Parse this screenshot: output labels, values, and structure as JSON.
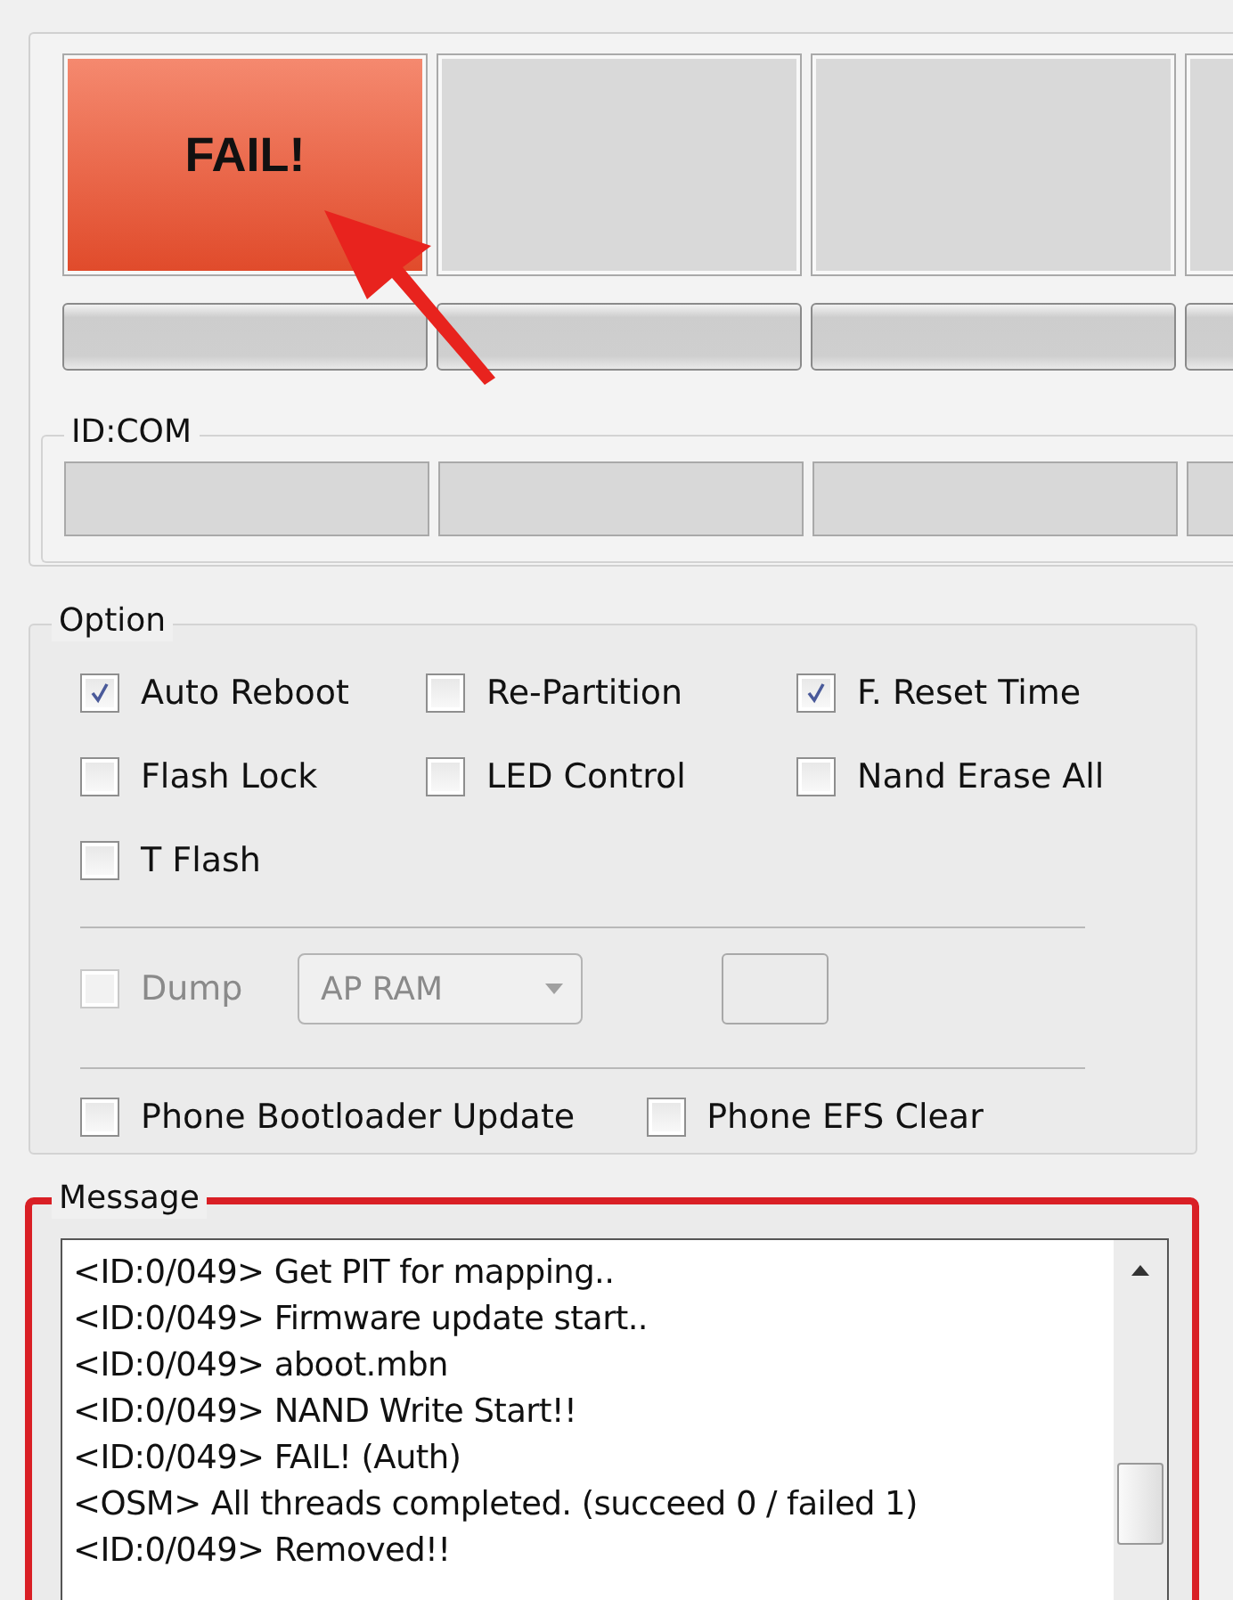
{
  "slots": [
    {
      "kind": "fail",
      "status": "FAIL!",
      "level": 0
    },
    {
      "kind": "idle",
      "level": 0
    },
    {
      "kind": "idle",
      "level": 0
    },
    {
      "kind": "idle",
      "level": 0
    }
  ],
  "id_com": {
    "title": "ID:COM"
  },
  "option": {
    "title": "Option",
    "checkboxes": [
      {
        "label": "Auto Reboot",
        "checked": true
      },
      {
        "label": "Re-Partition",
        "checked": false
      },
      {
        "label": "F. Reset Time",
        "checked": true
      },
      {
        "label": "Flash Lock",
        "checked": false
      },
      {
        "label": "LED Control",
        "checked": false
      },
      {
        "label": "Nand Erase All",
        "checked": false
      },
      {
        "label": "T Flash",
        "checked": false
      }
    ],
    "dump": {
      "label": "Dump",
      "checked": false,
      "disabled": true,
      "dropdown": "AP RAM"
    },
    "phone": [
      {
        "label": "Phone Bootloader Update",
        "checked": false
      },
      {
        "label": "Phone EFS Clear",
        "checked": false
      }
    ]
  },
  "message": {
    "title": "Message",
    "highlighted": true,
    "lines": [
      "<ID:0/049> Get PIT for mapping..",
      "<ID:0/049> Firmware update start..",
      "<ID:0/049> aboot.mbn",
      "<ID:0/049> NAND Write Start!!",
      "<ID:0/049> FAIL! (Auth)",
      "<OSM> All threads completed. (succeed 0 / failed 1)",
      "<ID:0/049> Removed!!"
    ]
  }
}
